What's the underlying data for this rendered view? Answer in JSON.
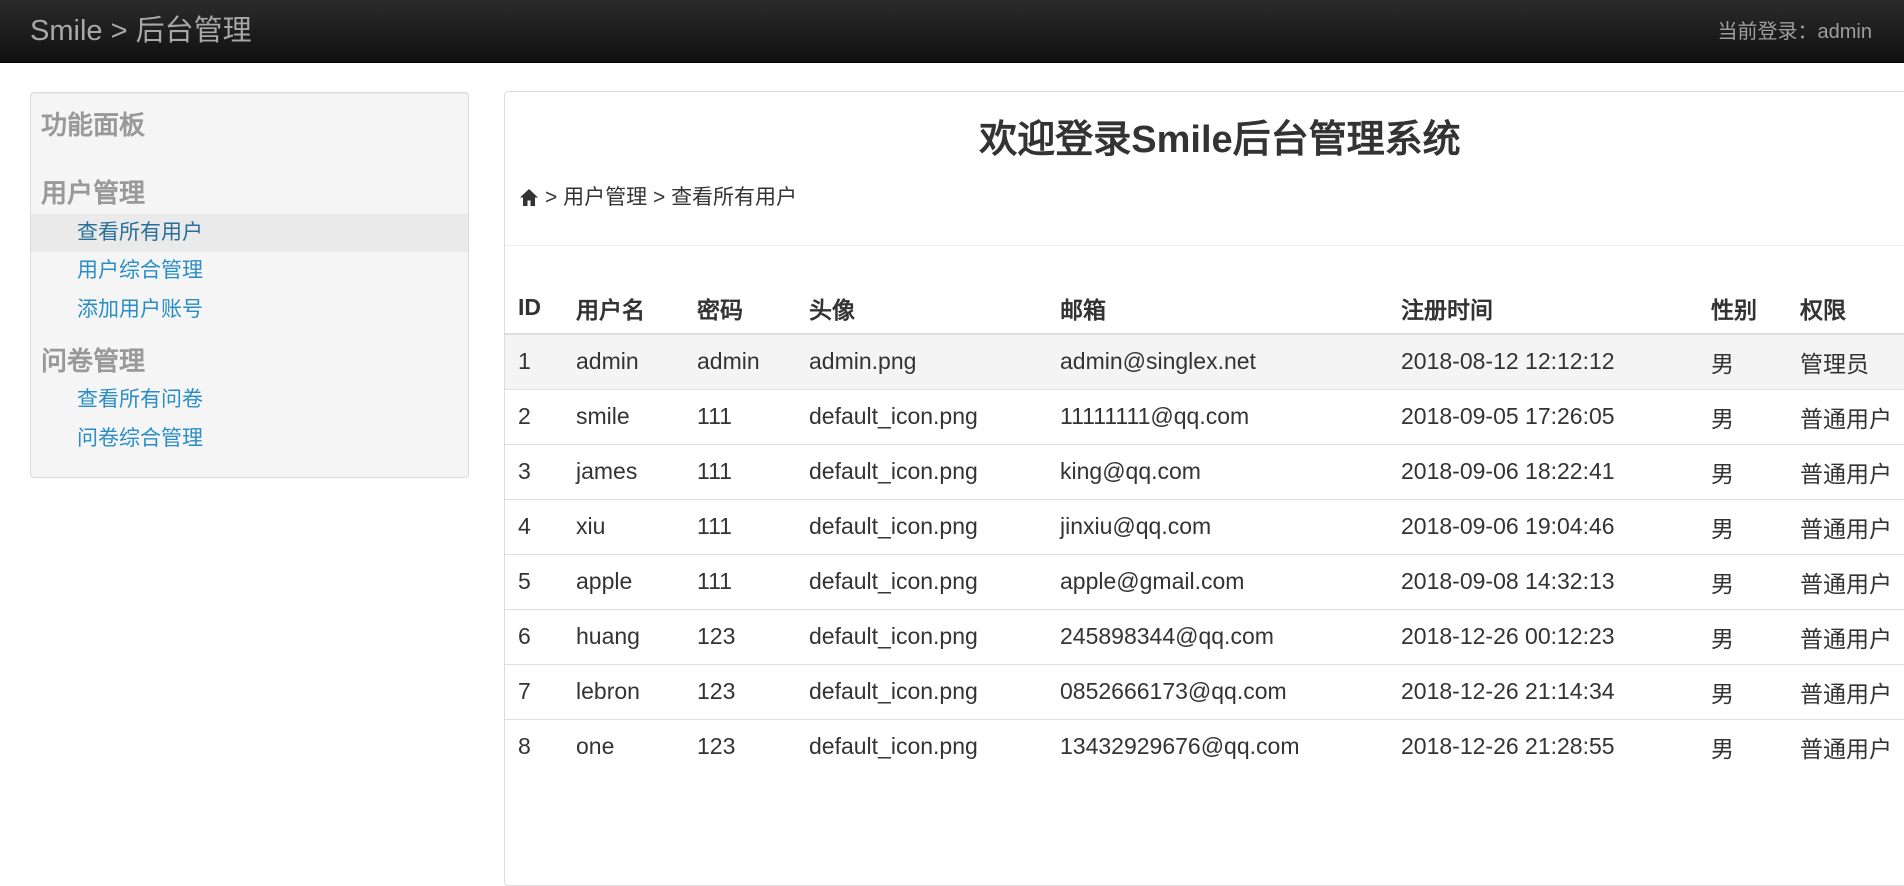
{
  "navbar": {
    "brand": "Smile > 后台管理",
    "login_text": "当前登录：admin"
  },
  "sidebar": {
    "title": "功能面板",
    "groups": [
      {
        "label": "用户管理",
        "items": [
          {
            "label": "查看所有用户",
            "active": true
          },
          {
            "label": "用户综合管理"
          },
          {
            "label": "添加用户账号"
          }
        ]
      },
      {
        "label": "问卷管理",
        "items": [
          {
            "label": "查看所有问卷"
          },
          {
            "label": "问卷综合管理"
          }
        ]
      }
    ]
  },
  "main": {
    "welcome": "欢迎登录Smile后台管理系统",
    "breadcrumb": {
      "icon": "home-icon",
      "sep": ">",
      "parts": [
        "用户管理",
        "查看所有用户"
      ]
    },
    "table": {
      "columns": [
        "ID",
        "用户名",
        "密码",
        "头像",
        "邮箱",
        "注册时间",
        "性别",
        "权限"
      ],
      "rows": [
        [
          "1",
          "admin",
          "admin",
          "admin.png",
          "admin@singlex.net",
          "2018-08-12 12:12:12",
          "男",
          "管理员"
        ],
        [
          "2",
          "smile",
          "111",
          "default_icon.png",
          "11111111@qq.com",
          "2018-09-05 17:26:05",
          "男",
          "普通用户"
        ],
        [
          "3",
          "james",
          "111",
          "default_icon.png",
          "king@qq.com",
          "2018-09-06 18:22:41",
          "男",
          "普通用户"
        ],
        [
          "4",
          "xiu",
          "111",
          "default_icon.png",
          "jinxiu@qq.com",
          "2018-09-06 19:04:46",
          "男",
          "普通用户"
        ],
        [
          "5",
          "apple",
          "111",
          "default_icon.png",
          "apple@gmail.com",
          "2018-09-08 14:32:13",
          "男",
          "普通用户"
        ],
        [
          "6",
          "huang",
          "123",
          "default_icon.png",
          "245898344@qq.com",
          "2018-12-26 00:12:23",
          "男",
          "普通用户"
        ],
        [
          "7",
          "lebron",
          "123",
          "default_icon.png",
          "0852666173@qq.com",
          "2018-12-26 21:14:34",
          "男",
          "普通用户"
        ],
        [
          "8",
          "one",
          "123",
          "default_icon.png",
          "13432929676@qq.com",
          "2018-12-26 21:28:55",
          "男",
          "普通用户"
        ]
      ]
    }
  },
  "colors": {
    "navbar": "#1a1a1a",
    "link": "#2a8ec6",
    "sidebar_bg": "#f5f5f5",
    "heading_gray": "#999999"
  }
}
